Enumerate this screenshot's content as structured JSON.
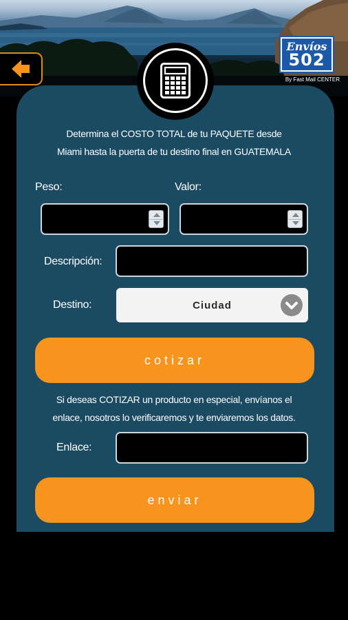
{
  "header": {
    "logo_line1": "Envíos",
    "logo_line2": "502",
    "byline": "By Fast Mail CENTER",
    "back_icon": "arrow-left-icon"
  },
  "form": {
    "intro_line1": "Determina el COSTO TOTAL de tu PAQUETE desde",
    "intro_line2": "Miami hasta la puerta de tu destino final en GUATEMALA",
    "peso_label": "Peso:",
    "valor_label": "Valor:",
    "peso_value": "",
    "valor_value": "",
    "descripcion_label": "Descripción:",
    "descripcion_value": "",
    "destino_label": "Destino:",
    "destino_value": "Ciudad",
    "cotizar_label": "cotizar",
    "special_line1": "Si deseas COTIZAR un producto en especial, envíanos el",
    "special_line2": "enlace, nosotros lo verificaremos y te enviaremos los datos.",
    "enlace_label": "Enlace:",
    "enlace_value": "",
    "enviar_label": "enviar"
  },
  "colors": {
    "accent": "#f7941d",
    "panel": "#1b4a63",
    "back_border": "#e08a1a"
  }
}
